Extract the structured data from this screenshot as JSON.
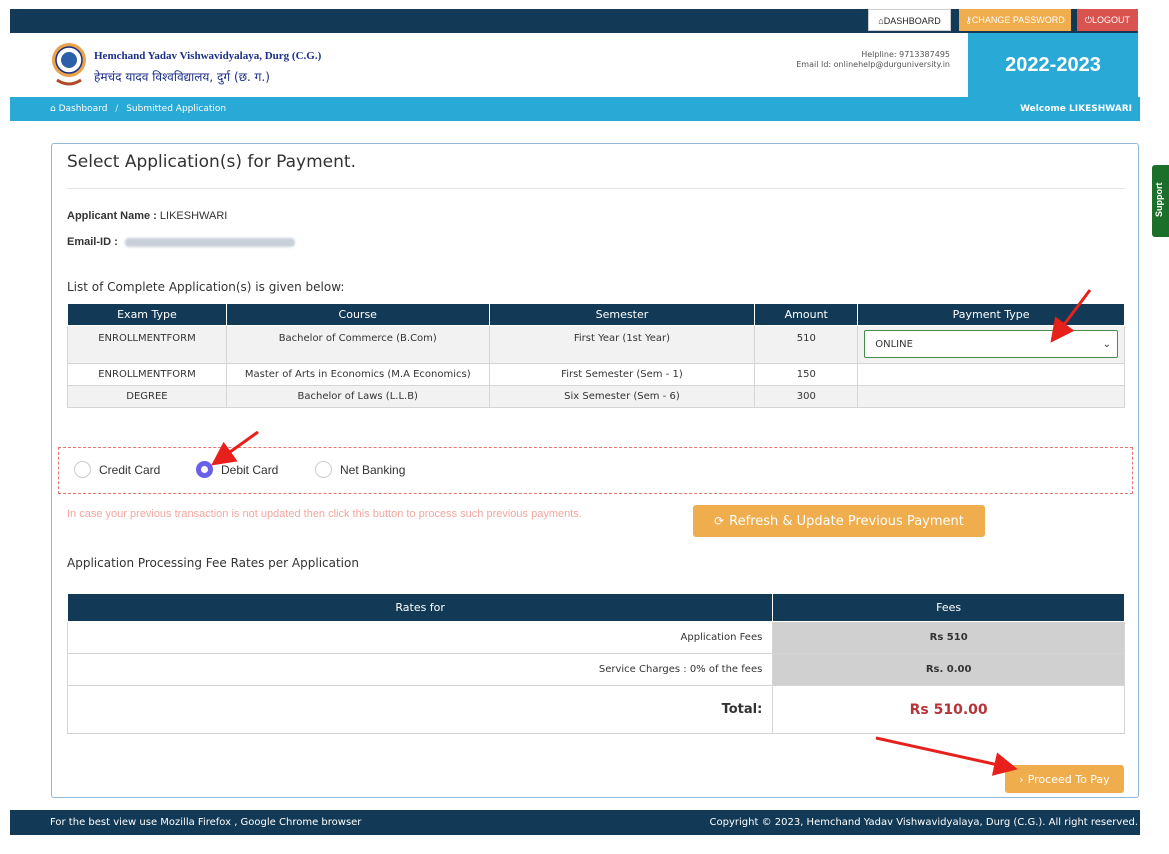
{
  "topbar": {
    "dashboard": "DASHBOARD",
    "change_password": "CHANGE PASSWORD",
    "logout": "LOGOUT"
  },
  "header": {
    "university_en": "Hemchand Yadav Vishwavidyalaya, Durg (C.G.)",
    "university_hi": "हेमचंद यादव विश्वविद्यालय, दुर्ग (छ. ग.)",
    "helpline": "Helpline: 9713387495",
    "email": "Email Id: onlinehelp@durguniversity.in",
    "year": "2022-2023"
  },
  "breadcrumb": {
    "home": "Dashboard",
    "current": "Submitted Application",
    "welcome": "Welcome LIKESHWARI"
  },
  "panel": {
    "title": "Select Application(s) for Payment.",
    "applicant_label": "Applicant Name :",
    "applicant_name": "LIKESHWARI",
    "email_label": "Email-ID :",
    "list_label": "List of Complete Application(s) is given below:"
  },
  "applications": {
    "headers": [
      "Exam Type",
      "Course",
      "Semester",
      "Amount",
      "Payment Type"
    ],
    "rows": [
      {
        "exam_type": "ENROLLMENTFORM",
        "course": "Bachelor of Commerce (B.Com)",
        "semester": "First Year (1st Year)",
        "amount": "510",
        "payment_type": "ONLINE"
      },
      {
        "exam_type": "ENROLLMENTFORM",
        "course": "Master of Arts in Economics (M.A Economics)",
        "semester": "First Semester (Sem - 1)",
        "amount": "150",
        "payment_type": ""
      },
      {
        "exam_type": "DEGREE",
        "course": "Bachelor of Laws (L.L.B)",
        "semester": "Six Semester (Sem - 6)",
        "amount": "300",
        "payment_type": ""
      }
    ]
  },
  "payment_methods": {
    "options": [
      "Credit Card",
      "Debit Card",
      "Net Banking"
    ],
    "selected": "Debit Card"
  },
  "refresh": {
    "note": "In case your previous transaction is not updated then click this button to process such previous payments.",
    "button": "Refresh & Update Previous Payment"
  },
  "fees": {
    "section_label": "Application Processing Fee Rates per Application",
    "headers": [
      "Rates for",
      "Fees"
    ],
    "application_fees_label": "Application Fees",
    "application_fees_value": "Rs 510",
    "service_label": "Service Charges : 0% of the fees",
    "service_value": "Rs. 0.00",
    "total_label": "Total:",
    "total_value": "Rs 510.00"
  },
  "proceed": "Proceed To Pay",
  "support": "Support",
  "footer": {
    "left": "For the best view use Mozilla Firefox , Google Chrome browser",
    "right": "Copyright © 2023, Hemchand Yadav Vishwavidyalaya, Durg (C.G.). All right reserved."
  },
  "colors": {
    "navy": "#123a56",
    "accent_blue": "#29a9d6",
    "orange": "#f0ad4e",
    "logout_red": "#d9534f",
    "total_red": "#b3353a",
    "annotation_arrow": "#e8201c"
  }
}
